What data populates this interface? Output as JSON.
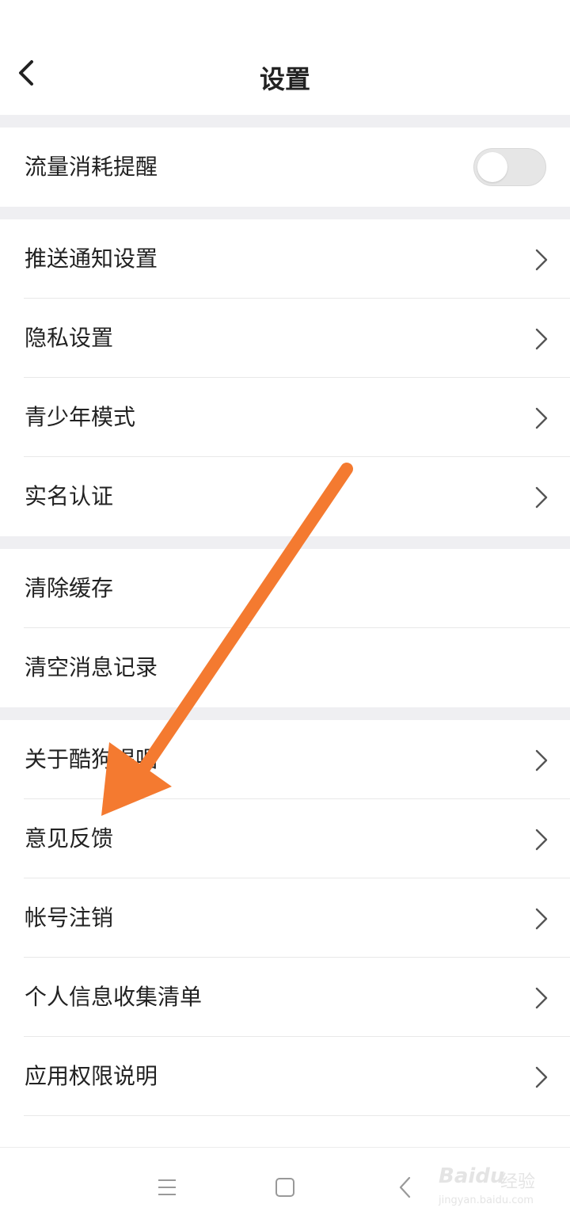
{
  "header": {
    "title": "设置"
  },
  "groups": [
    {
      "items": [
        {
          "label": "流量消耗提醒",
          "control": "toggle",
          "checked": false
        }
      ]
    },
    {
      "items": [
        {
          "label": "推送通知设置",
          "control": "chevron"
        },
        {
          "label": "隐私设置",
          "control": "chevron"
        },
        {
          "label": "青少年模式",
          "control": "chevron"
        },
        {
          "label": "实名认证",
          "control": "chevron"
        }
      ]
    },
    {
      "items": [
        {
          "label": "清除缓存",
          "control": "none"
        },
        {
          "label": "清空消息记录",
          "control": "none"
        }
      ]
    },
    {
      "items": [
        {
          "label": "关于酷狗唱唱",
          "control": "chevron"
        },
        {
          "label": "意见反馈",
          "control": "chevron"
        },
        {
          "label": "帐号注销",
          "control": "chevron"
        },
        {
          "label": "个人信息收集清单",
          "control": "chevron"
        },
        {
          "label": "应用权限说明",
          "control": "chevron"
        }
      ]
    }
  ],
  "nav": {
    "buttons": [
      "menu-icon",
      "home-square-icon",
      "back-triangle-icon"
    ]
  },
  "watermark": {
    "brand": "Bai",
    "brand2": "du",
    "text_cn": "经验",
    "url": "jingyan.baidu.com"
  },
  "colors": {
    "arrow": "#f47a30",
    "separator": "#efeff2",
    "toggle_off": "#e6e6e6",
    "chevron": "#555555"
  }
}
